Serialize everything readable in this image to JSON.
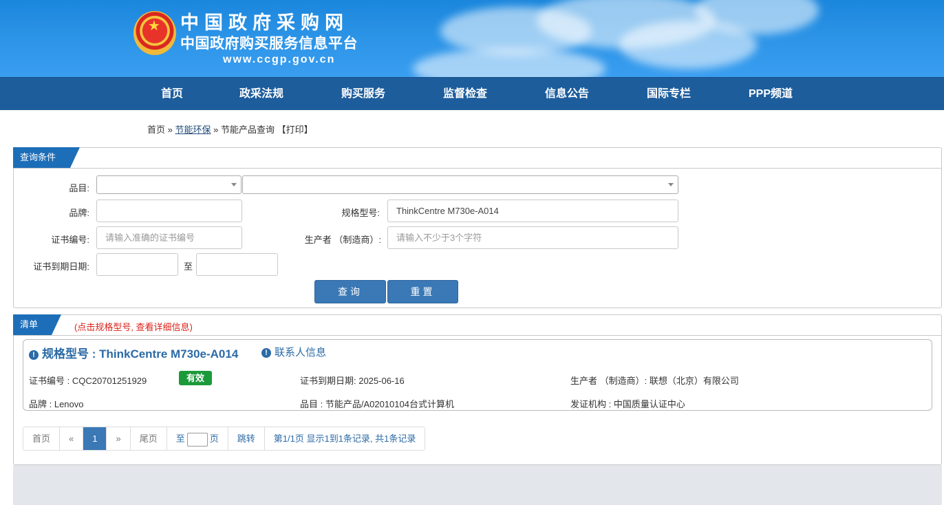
{
  "header": {
    "title_cn": "中国政府采购网",
    "subtitle_cn": "中国政府购买服务信息平台",
    "url": "www.ccgp.gov.cn",
    "emblem_icon": "national-emblem-icon"
  },
  "nav": {
    "items": [
      "首页",
      "政采法规",
      "购买服务",
      "监督检查",
      "信息公告",
      "国际专栏",
      "PPP频道"
    ]
  },
  "breadcrumb": {
    "home": "首页",
    "sep1": "»",
    "section": "节能环保",
    "sep2": "»",
    "page": "节能产品查询",
    "print": "【打印】"
  },
  "query": {
    "tab_label": "查询条件",
    "category_label": "品目:",
    "category1_value": "",
    "category2_value": "",
    "brand_label": "品牌:",
    "brand_value": "",
    "model_label": "规格型号:",
    "model_value": "ThinkCentre M730e-A014",
    "cert_no_label": "证书编号:",
    "cert_no_placeholder": "请输入准确的证书编号",
    "producer_label": "生产者 （制造商）:",
    "producer_placeholder": "请输入不少于3个字符",
    "expiry_label": "证书到期日期:",
    "expiry_from": "",
    "expiry_to_label": "至",
    "expiry_to": "",
    "search_button": "查询",
    "reset_button": "重置"
  },
  "list": {
    "tab_label": "清单",
    "hint": "(点击规格型号, 查看详细信息)",
    "items": [
      {
        "title": "规格型号 : ThinkCentre M730e-A014",
        "contact": "联系人信息",
        "cert_no": "证书编号 : CQC20701251929",
        "status": "有效",
        "expiry": "证书到期日期: 2025-06-16",
        "producer": "生产者 （制造商）: 联想（北京）有限公司",
        "brand": "品牌 : Lenovo",
        "category": "品目 : 节能产品/A02010104台式计算机",
        "issuer": "发证机构 : 中国质量认证中心"
      }
    ]
  },
  "pager": {
    "first": "首页",
    "prev": "«",
    "current": "1",
    "next": "»",
    "last": "尾页",
    "goto_prefix": "至",
    "goto_suffix": "页",
    "jump": "跳转",
    "summary": "第1/1页  显示1到1条记录, 共1条记录"
  },
  "colors": {
    "nav_bg": "#1d5d9c",
    "accent": "#3a78b6",
    "status_valid": "#1b9a3a",
    "hint_red": "#d9231a"
  }
}
